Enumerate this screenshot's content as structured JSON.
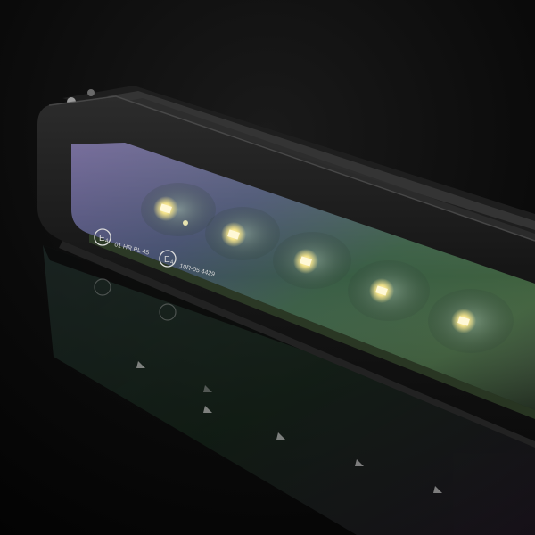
{
  "photo": {
    "background_color": "#050505",
    "housing_color": "#1a1a1a",
    "lens_tint_top": "#6a5a8a",
    "lens_tint_bottom": "#3a6a4a",
    "led_color": "#fff6c8"
  },
  "markings": {
    "mark_1_symbol": "E",
    "mark_1_subscript": "4",
    "mark_1_text": "01 HR PL 45",
    "mark_2_symbol": "E",
    "mark_2_subscript": "4",
    "mark_2_text": "10R-05 4429"
  },
  "leds": {
    "count": 5
  }
}
